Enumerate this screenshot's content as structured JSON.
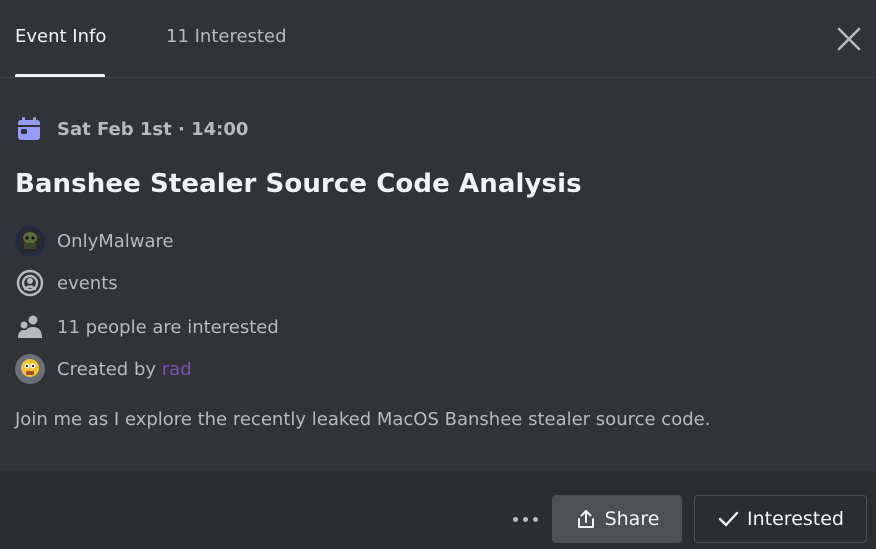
{
  "tabs": {
    "event_info": "Event Info",
    "interested": "11 Interested"
  },
  "event": {
    "date": "Sat Feb 1st · 14:00",
    "title": "Banshee Stealer Source Code Analysis",
    "server": "OnlyMalware",
    "channel": "events",
    "interested_count_text": "11 people are interested",
    "created_by_prefix": "Created by",
    "creator": "rad",
    "description": "Join me as I explore the recently leaked MacOS Banshee stealer source code."
  },
  "footer": {
    "more_label": "...",
    "share_label": "Share",
    "interested_label": "Interested"
  },
  "icons": {
    "close": "close-icon",
    "calendar": "calendar-icon",
    "server_avatar": "server-avatar",
    "channel": "stage-channel-icon",
    "people": "people-icon",
    "creator_avatar": "creator-avatar",
    "share": "share-icon",
    "check": "check-icon"
  },
  "colors": {
    "background": "#313338",
    "footer_background": "#2b2d31",
    "calendar_accent": "#949cf7",
    "creator_link": "#7f4fb0",
    "share_button": "#4e5058"
  }
}
